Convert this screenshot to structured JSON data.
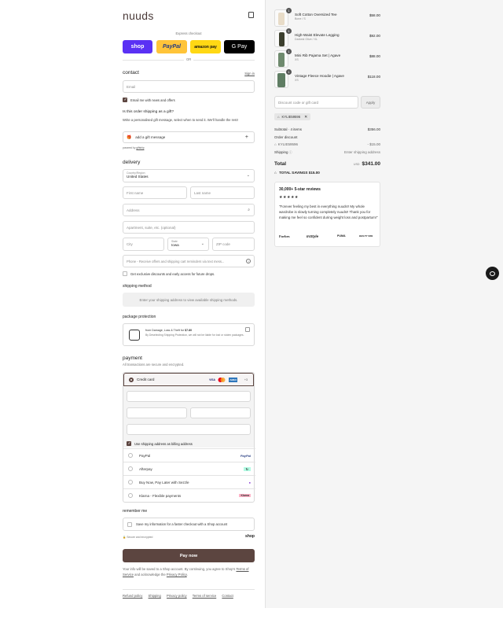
{
  "brand": "nuuds",
  "express": {
    "label": "Express checkout",
    "buttons": [
      {
        "label": "shop",
        "bg": "#5a31f4",
        "color": "#fff"
      },
      {
        "label": "PayPal",
        "bg": "#ffc439",
        "color": "#253b80"
      },
      {
        "label": "amazon pay",
        "bg": "#ffd814",
        "color": "#111"
      },
      {
        "label": "G Pay",
        "bg": "#000",
        "color": "#fff"
      }
    ],
    "or": "OR"
  },
  "contact": {
    "title": "contact",
    "sign_in": "Sign in",
    "email_placeholder": "Email",
    "news_label": "Email me with news and offers"
  },
  "gift": {
    "question": "Is this order shipping as a gift?",
    "desc": "Write a personalised gift message, select when to send it. We'll handle the rest!",
    "add_label": "add a gift message",
    "powered": "powered by",
    "powered_link": "giftship"
  },
  "delivery": {
    "title": "delivery",
    "country_label": "Country/Region",
    "country_value": "United States",
    "first_name": "First name",
    "last_name": "Last name",
    "address": "Address",
    "apartment": "Apartment, suite, etc. (optional)",
    "city": "City",
    "state_label": "State",
    "state_value": "Iowa",
    "zip": "ZIP code",
    "phone": "Phone - Receive offers and shipping cart reminders via text mess...",
    "exclusive_label": "Get exclusive discounts and early access for future drops."
  },
  "shipping_method": {
    "title": "shipping method",
    "placeholder": "Enter your shipping address to view available shipping methods."
  },
  "protection": {
    "title": "package protection",
    "line1_prefix": "from Damage, Loss & Theft for ",
    "price": "$7.80",
    "line2": "By Deselecting Shipping Protection, we will not be liable for lost or stolen packages."
  },
  "payment": {
    "title": "payment",
    "subtitle": "All transactions are secure and encrypted.",
    "credit_card": "Credit card",
    "card_brands": [
      "VISA",
      "MC",
      "AMEX"
    ],
    "more": "+3",
    "billing_label": "Use shipping address as billing address",
    "methods": [
      {
        "label": "PayPal",
        "logo": "PayPal",
        "color": "#253b80",
        "bg": "transparent"
      },
      {
        "label": "Afterpay",
        "logo": "↻",
        "color": "#000",
        "bg": "#b2fce4"
      },
      {
        "label": "Buy Now, Pay Later with Sezzle",
        "logo": "●",
        "color": "#8333d4",
        "bg": "transparent"
      },
      {
        "label": "Klarna - Flexible payments",
        "logo": "Klarna",
        "color": "#000",
        "bg": "#ffb3c7"
      }
    ]
  },
  "remember": {
    "title": "remember me",
    "save_label": "Save my information for a faster checkout with a Shop account",
    "secure": "Secure and encrypted",
    "shop": "shop"
  },
  "pay_now": "Pay now",
  "legal": {
    "text1": "Your info will be saved to a Shop account. By continuing, you agree to Shop's",
    "terms": "Terms of Service",
    "text2": "and acknowledge the",
    "privacy": "Privacy Policy",
    "end": "."
  },
  "footer": [
    "Refund policy",
    "Shipping",
    "Privacy policy",
    "Terms of service",
    "Contact"
  ],
  "cart": {
    "items": [
      {
        "name": "Soft Cotton Oversized Tee",
        "variant": "Bone / S",
        "price": "$58.00",
        "qty": "1"
      },
      {
        "name": "High-Waist Elevate Legging",
        "variant": "Darkest Olive / XL",
        "price": "$92.00",
        "qty": "1"
      },
      {
        "name": "Mini Rib Pajama Set | Agave",
        "variant": "XS",
        "price": "$88.00",
        "qty": "1"
      },
      {
        "name": "Vintage Fleece Hoodie | Agave",
        "variant": "XS",
        "price": "$118.00",
        "qty": "1"
      }
    ],
    "discount_placeholder": "Discount code or gift card",
    "apply": "Apply",
    "code_tag": "KYLIE59596",
    "subtotal_label": "Subtotal · 4 items",
    "subtotal": "$356.00",
    "order_discount": "Order discount",
    "discount_code": "KYLIE59596",
    "discount_amount": "- $15.00",
    "shipping_label": "Shipping",
    "shipping_value": "Enter shipping address",
    "total_label": "Total",
    "currency": "USD",
    "total": "$341.00",
    "savings_label": "TOTAL SAVINGS",
    "savings": "$15.00"
  },
  "reviews": {
    "title": "30,000+ 5-star reviews",
    "stars": "★★★★★",
    "quote": "\"Forever feeling my best in everything nuuds!! My whole wardrobe is slowly turning completely nuuds!! Thank you for making me feel so confident during weight loss and postpartum!\"",
    "press": [
      "Forbes",
      "InStyle",
      "PUMA",
      "BEAUTY SIDE"
    ]
  },
  "colors": {
    "accent": "#5c4540",
    "brand": "#4a3a38"
  }
}
